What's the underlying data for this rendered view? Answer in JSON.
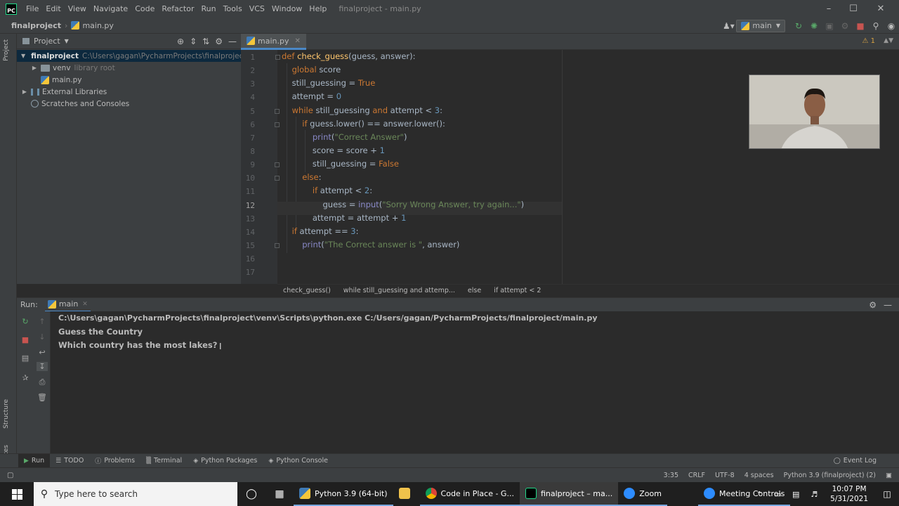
{
  "menubar": {
    "items": [
      "File",
      "Edit",
      "View",
      "Navigate",
      "Code",
      "Refactor",
      "Run",
      "Tools",
      "VCS",
      "Window",
      "Help"
    ],
    "window_title": "finalproject - main.py"
  },
  "navbar": {
    "project": "finalproject",
    "file": "main.py",
    "run_config": "main"
  },
  "left_stripe": {
    "project_tab": "Project",
    "structure_tab": "Structure",
    "favorites_tab": "Favorites"
  },
  "project_panel": {
    "title": "Project",
    "tree": [
      {
        "label": "finalproject",
        "hint": "C:\\Users\\gagan\\PycharmProjects\\finalproject"
      },
      {
        "label": "venv",
        "hint": "library root"
      },
      {
        "label": "main.py",
        "hint": ""
      },
      {
        "label": "External Libraries",
        "hint": ""
      },
      {
        "label": "Scratches and Consoles",
        "hint": ""
      }
    ]
  },
  "editor": {
    "tab": "main.py",
    "warnings": "1",
    "line_numbers": [
      "1",
      "2",
      "3",
      "4",
      "5",
      "6",
      "7",
      "8",
      "9",
      "10",
      "11",
      "12",
      "13",
      "14",
      "15",
      "16",
      "17"
    ],
    "breadcrumbs": [
      "check_guess()",
      "while still_guessing and attemp...",
      "else",
      "if attempt < 2"
    ]
  },
  "run_panel": {
    "label": "Run:",
    "tab": "main",
    "console": [
      "C:\\Users\\gagan\\PycharmProjects\\finalproject\\venv\\Scripts\\python.exe C:/Users/gagan/PycharmProjects/finalproject/main.py",
      "Guess the Country",
      "Which country has the most lakes?"
    ]
  },
  "bottom_tabs": [
    "Run",
    "TODO",
    "Problems",
    "Terminal",
    "Python Packages",
    "Python Console"
  ],
  "event_log": "Event Log",
  "status": {
    "position": "3:35",
    "line_sep": "CRLF",
    "encoding": "UTF-8",
    "indent": "4 spaces",
    "interpreter": "Python 3.9 (finalproject) (2)"
  },
  "taskbar": {
    "search_placeholder": "Type here to search",
    "apps": [
      "Python 3.9 (64-bit)",
      "Code in Place - G...",
      "finalproject – ma...",
      "Zoom",
      "Meeting Controls"
    ],
    "time": "10:07 PM",
    "date": "5/31/2021"
  },
  "colors": {
    "accent": "#4a88c7",
    "keyword": "#cc7832",
    "string": "#6a8759",
    "number": "#6897bb",
    "function": "#ffc66d"
  }
}
